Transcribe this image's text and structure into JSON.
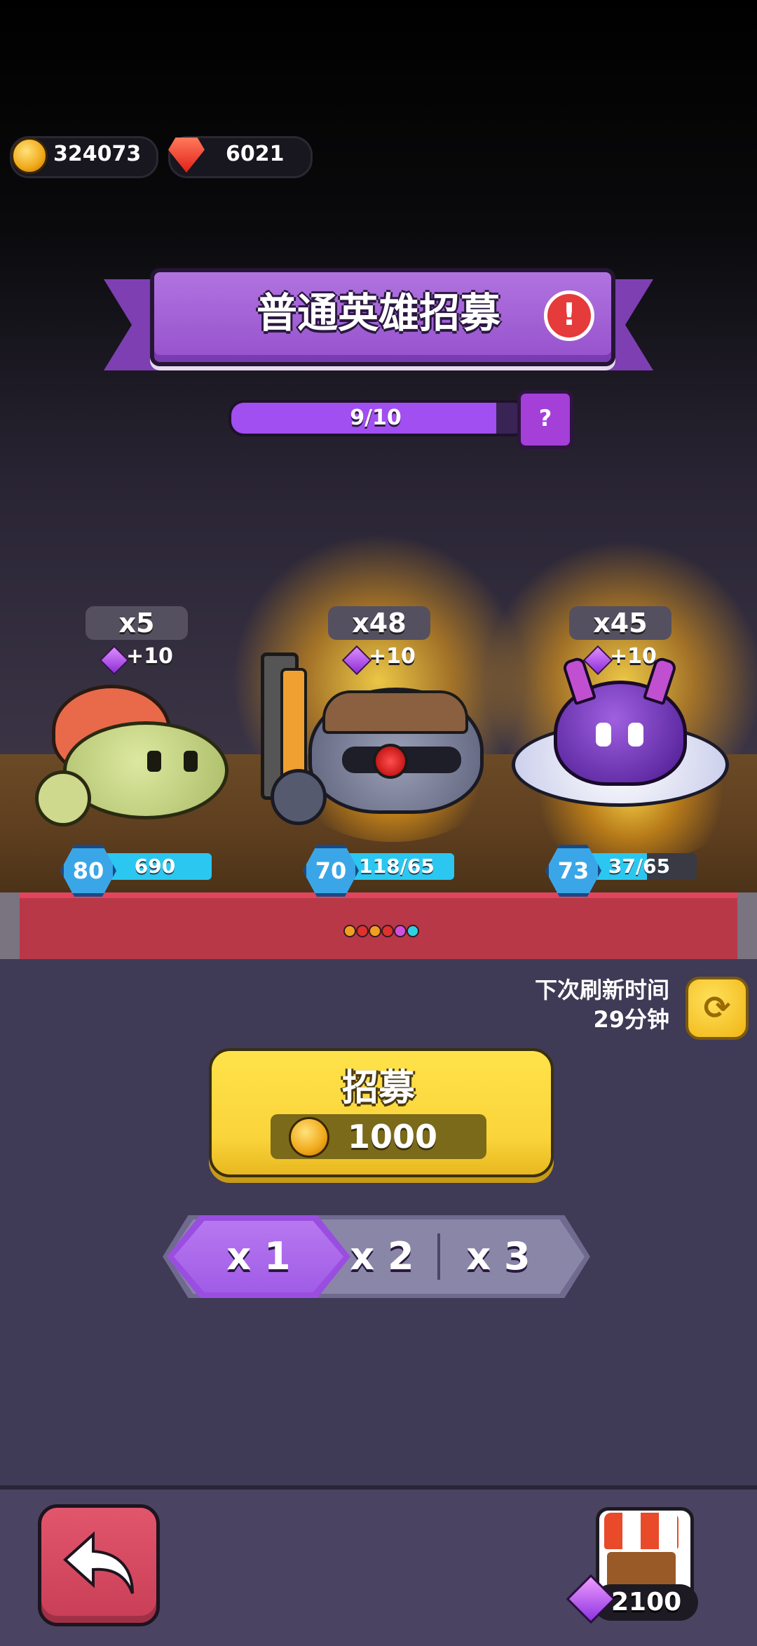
{
  "header": {
    "coins": "324073",
    "gems": "6021"
  },
  "banner": {
    "title": "普通英雄招募"
  },
  "progress": {
    "text": "9/10",
    "fraction": 0.9,
    "help_icon": "?"
  },
  "heroes": [
    {
      "count": "x5",
      "bonus": "+10",
      "level": "80",
      "exp_text": "690",
      "exp_fraction": 1.0
    },
    {
      "count": "x48",
      "bonus": "+10",
      "level": "70",
      "exp_text": "118/65",
      "exp_fraction": 1.0
    },
    {
      "count": "x45",
      "bonus": "+10",
      "level": "73",
      "exp_text": "37/65",
      "exp_fraction": 0.57
    }
  ],
  "dots": [
    "#f0a020",
    "#e03030",
    "#f0a020",
    "#e03030",
    "#d050e0",
    "#30d0e0"
  ],
  "refresh": {
    "label": "下次刷新时间",
    "time": "29分钟"
  },
  "recruit": {
    "title": "招募",
    "cost": "1000"
  },
  "multiplier": {
    "options": [
      "x 1",
      "x 2",
      "x 3"
    ],
    "selected": "x 1"
  },
  "shop": {
    "cost": "2100"
  }
}
